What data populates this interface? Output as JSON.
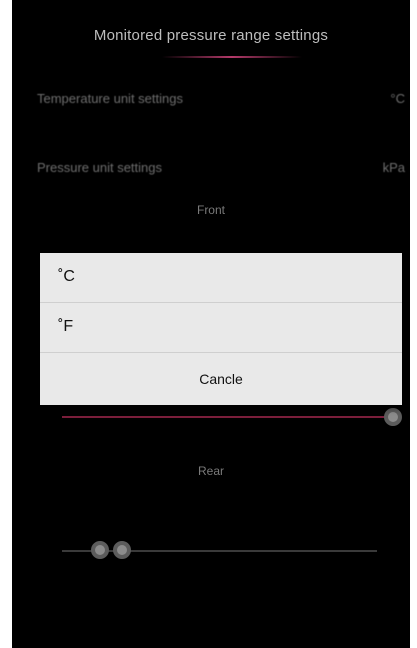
{
  "header": {
    "title": "Monitored pressure range settings"
  },
  "settings": {
    "temperature_label": "Temperature unit settings",
    "temperature_value": "°C",
    "pressure_label": "Pressure unit settings",
    "pressure_value": "kPa"
  },
  "sections": {
    "front": "Front",
    "rear": "Rear"
  },
  "dialog": {
    "options": [
      "˚C",
      "˚F"
    ],
    "cancel_label": "Cancle"
  },
  "colors": {
    "accent": "#b43a6a",
    "background": "#000000",
    "dialog_bg": "#e9e9e9"
  }
}
